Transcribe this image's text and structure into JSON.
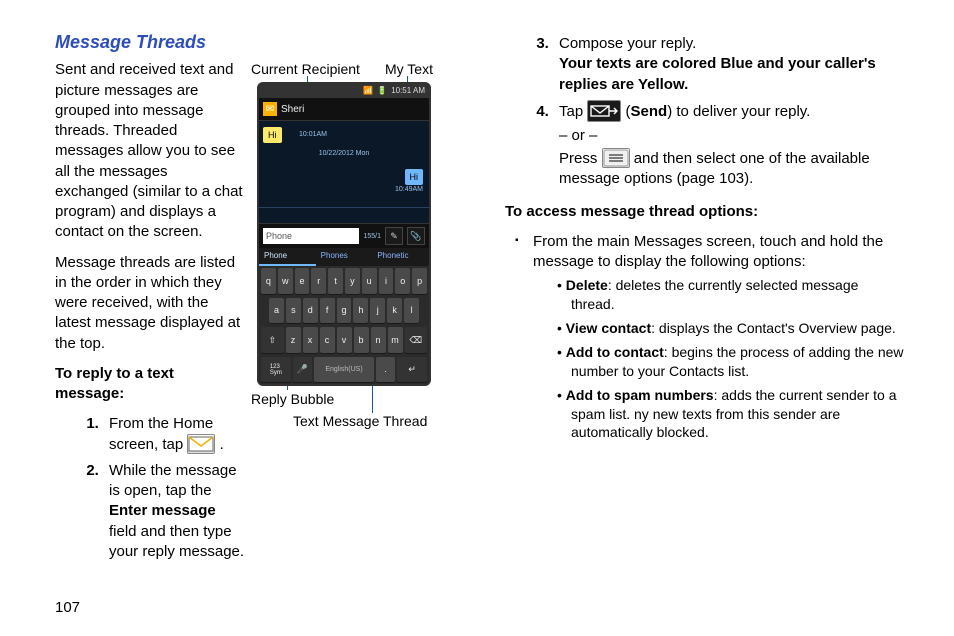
{
  "title": "Message Threads",
  "intro_p1": "Sent and received text and picture messages are grouped into message threads. Threaded messages allow you to see all the messages exchanged (similar to a chat program) and displays a contact on the screen.",
  "intro_p2": "Message threads are listed in the order in which they were received, with the latest message displayed at the top.",
  "reply_heading": "To reply to a text message:",
  "step1_a": "From the Home screen, tap ",
  "step1_b": " .",
  "step2_a": "While the message is open, tap the ",
  "step2_b": "Enter message",
  "step2_c": " field and then type your reply message.",
  "callouts": {
    "current_recipient": "Current Recipient",
    "my_text": "My Text",
    "reply_bubble": "Reply Bubble",
    "thread": "Text Message Thread"
  },
  "step3_a": "Compose your reply.",
  "step3_b": "Your texts are colored Blue and your caller's replies are Yellow.",
  "step4_a": "Tap ",
  "step4_b": " (",
  "step4_c": "Send",
  "step4_d": ") to deliver your reply.",
  "step4_or": "– or –",
  "step4_e": "Press ",
  "step4_f": " and then select one of the available message options (page 103).",
  "access_heading": "To access message thread options:",
  "opt_intro": "From the main Messages screen, touch and hold the message to display the following options:",
  "bullets": {
    "delete_t": "Delete",
    "delete_d": ": deletes the currently selected message thread.",
    "view_t": "View contact",
    "view_d": ": displays the Contact's Overview page.",
    "add_t": "Add to contact",
    "add_d": ": begins the process of adding the new number to your Contacts list.",
    "spam_t": "Add to spam numbers",
    "spam_d": ": adds the current sender to a spam list. ny new texts from this sender are automatically blocked."
  },
  "phone": {
    "time": "10:51 AM",
    "recipient": "Sheri",
    "date": "10/22/2012 Mon",
    "t1": "10:01AM",
    "t2": "10:49AM",
    "bubble_yellow": "Hi",
    "bubble_blue": "Hi",
    "input": "Phone",
    "counter": "155/1",
    "tabs": [
      "Phone",
      "Phones",
      "Phonetic"
    ],
    "rows": [
      [
        "q",
        "w",
        "e",
        "r",
        "t",
        "y",
        "u",
        "i",
        "o",
        "p"
      ],
      [
        "a",
        "s",
        "d",
        "f",
        "g",
        "h",
        "j",
        "k",
        "l"
      ]
    ],
    "row3": {
      "shift": "⇧",
      "keys": [
        "z",
        "x",
        "c",
        "v",
        "b",
        "n",
        "m"
      ],
      "del": "⌫"
    },
    "row4": {
      "sym": "123\nSym",
      "mic": "🎤",
      "space": "English(US)",
      "dot": ".",
      "enter": "↵"
    }
  },
  "page_number": "107"
}
